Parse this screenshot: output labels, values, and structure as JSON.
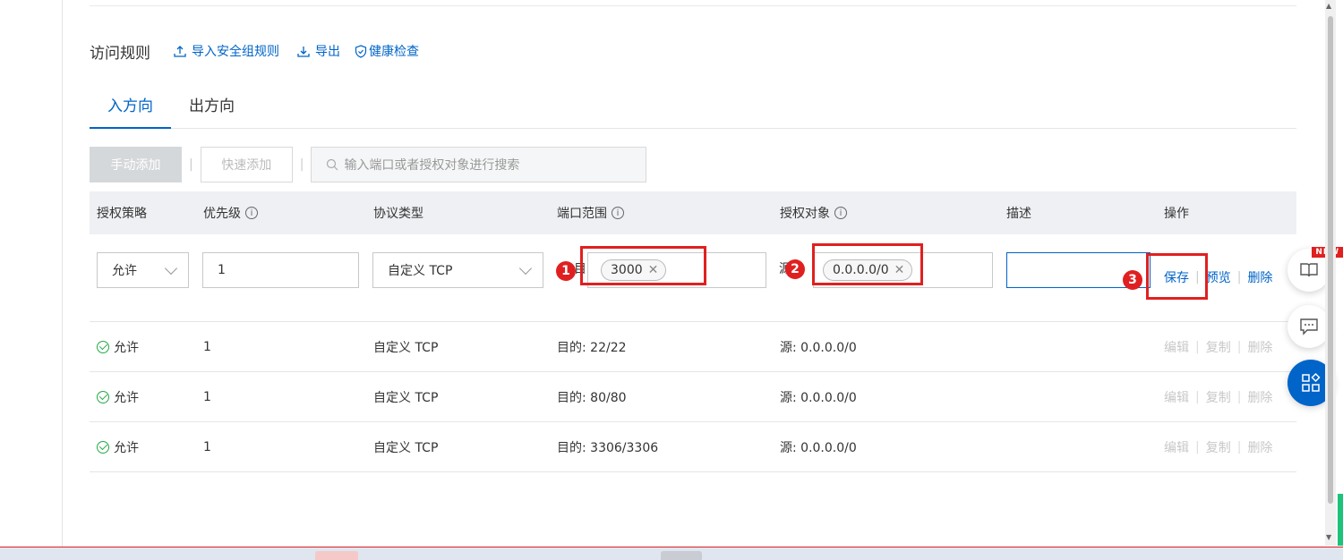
{
  "section": {
    "title": "访问规则",
    "links": [
      "导入安全组规则",
      "导出",
      "健康检查"
    ]
  },
  "tabs": [
    "入方向",
    "出方向"
  ],
  "toolbar": {
    "manual_add": "手动添加",
    "quick_add": "快速添加",
    "search_placeholder": "输入端口或者授权对象进行搜索"
  },
  "table": {
    "headers": [
      "授权策略",
      "优先级",
      "协议类型",
      "端口范围",
      "授权对象",
      "描述",
      "操作"
    ],
    "edit_row": {
      "policy": "允许",
      "priority": "1",
      "protocol": "自定义 TCP",
      "port_prefix": "目的:",
      "port_tag": "3000",
      "source_prefix": "源:",
      "source_tag": "0.0.0.0/0",
      "description": "",
      "ops": [
        "保存",
        "预览",
        "删除"
      ]
    },
    "rows": [
      {
        "policy": "允许",
        "priority": "1",
        "protocol": "自定义 TCP",
        "port": "目的: 22/22",
        "source": "源: 0.0.0.0/0"
      },
      {
        "policy": "允许",
        "priority": "1",
        "protocol": "自定义 TCP",
        "port": "目的: 80/80",
        "source": "源: 0.0.0.0/0"
      },
      {
        "policy": "允许",
        "priority": "1",
        "protocol": "自定义 TCP",
        "port": "目的: 3306/3306",
        "source": "源: 0.0.0.0/0"
      }
    ],
    "row_ops": [
      "编辑",
      "复制",
      "删除"
    ]
  },
  "annotations": [
    "1",
    "2",
    "3"
  ],
  "float": {
    "new_badge": "NEW"
  },
  "colors": {
    "accent": "#0064c8",
    "highlight": "#e02020",
    "success": "#23a845"
  }
}
